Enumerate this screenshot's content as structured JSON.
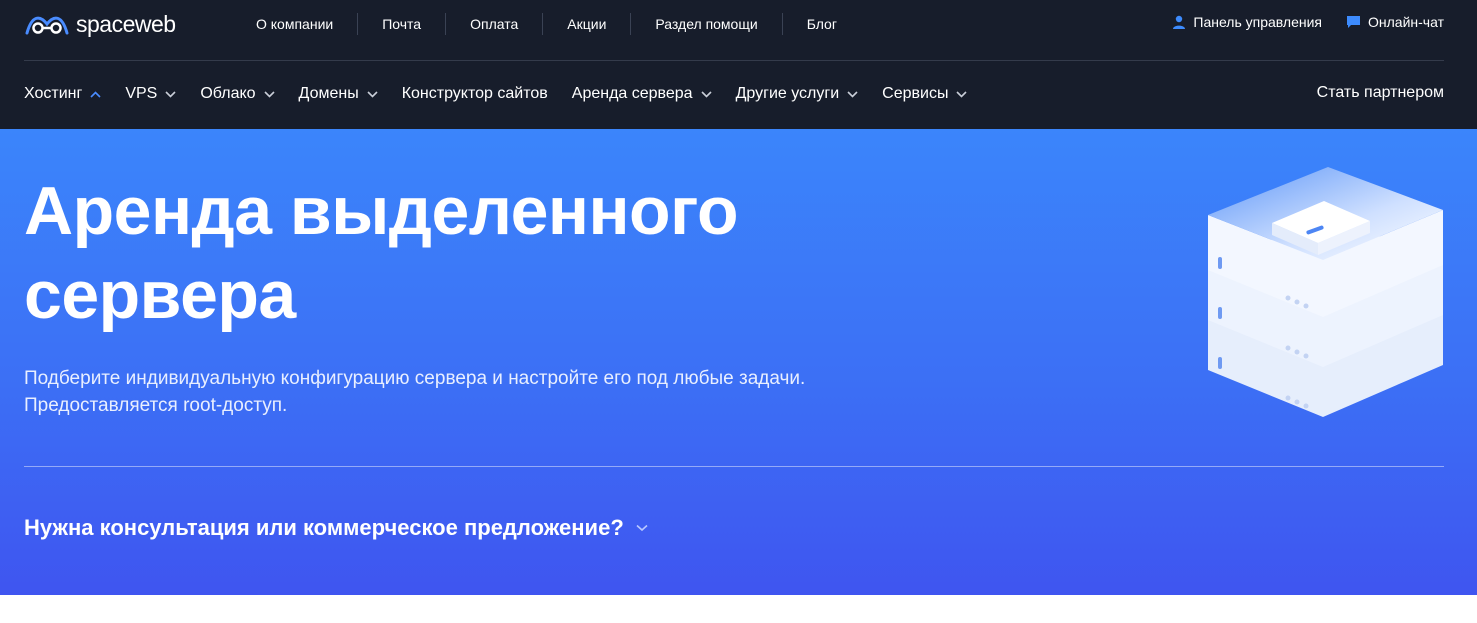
{
  "brand": {
    "name": "spaceweb"
  },
  "top_nav": {
    "links": [
      "О компании",
      "Почта",
      "Оплата",
      "Акции",
      "Раздел помощи",
      "Блог"
    ],
    "panel_label": "Панель управления",
    "chat_label": "Онлайн-чат"
  },
  "main_nav": {
    "items": [
      {
        "label": "Хостинг",
        "icon": "chevron-up-icon"
      },
      {
        "label": "VPS",
        "icon": "chevron-down-icon"
      },
      {
        "label": "Облако",
        "icon": "chevron-down-icon"
      },
      {
        "label": "Домены",
        "icon": "chevron-down-icon"
      },
      {
        "label": "Конструктор сайтов",
        "icon": ""
      },
      {
        "label": "Аренда сервера",
        "icon": "chevron-down-icon"
      },
      {
        "label": "Другие услуги",
        "icon": "chevron-down-icon"
      },
      {
        "label": "Сервисы",
        "icon": "chevron-down-icon"
      }
    ],
    "partner_label": "Стать партнером"
  },
  "hero": {
    "title_line1": "Аренда выделенного",
    "title_line2": "сервера",
    "subtitle_line1": "Подберите индивидуальную конфигурацию сервера и настройте его под любые задачи.",
    "subtitle_line2": "Предоставляется root-доступ.",
    "consult_label": "Нужна консультация или коммерческое предложение?"
  },
  "colors": {
    "header_bg": "#171d2b",
    "hero_top": "#3b85fb",
    "hero_bottom": "#3f55f0",
    "accent": "#3d8bfd"
  }
}
